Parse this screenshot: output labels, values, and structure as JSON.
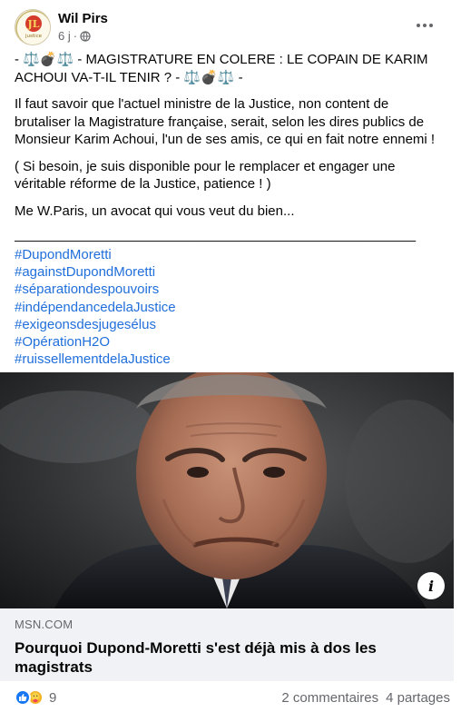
{
  "post": {
    "author": "Wil Pirs",
    "avatar_text": "justice",
    "time": "6 j",
    "time_separator": "·",
    "more_icon": "ellipsis-icon",
    "privacy_icon": "globe-icon"
  },
  "content": {
    "headline": "- ⚖️💣⚖️ - MAGISTRATURE EN COLERE : LE COPAIN DE KARIM ACHOUI VA-T-IL TENIR ? - ⚖️💣⚖️ -",
    "paragraph1": "Il faut savoir que l'actuel ministre de la Justice, non content de brutaliser la Magistrature française, serait, selon les dires publics de Monsieur Karim Achoui, l'un de ses amis, ce qui en fait notre ennemi !",
    "paragraph2": "( Si besoin, je suis disponible pour le remplacer et engager une véritable réforme de la Justice, patience ! )",
    "paragraph3": "Me W.Paris, un avocat qui vous veut du bien...",
    "rule": "_____________________________________________________",
    "hashtags": [
      "#DupondMoretti",
      "#againstDupondMoretti",
      "#séparationdespouvoirs",
      "#indépendancedelaJustice",
      "#exigeonsdesjugesélus",
      "#OpérationH2O",
      "#ruissellementdelaJustice"
    ]
  },
  "link": {
    "domain": "MSN.COM",
    "title": "Pourquoi Dupond-Moretti s'est déjà mis à dos les magistrats",
    "info_icon": "info-icon"
  },
  "footer": {
    "reaction_count": "9",
    "comments": "2 commentaires",
    "shares": "4 partages"
  },
  "colors": {
    "link_blue": "#216fdb",
    "secondary_text": "#65676b",
    "like_blue": "#1877f2",
    "care_yellow": "#f7b125"
  }
}
